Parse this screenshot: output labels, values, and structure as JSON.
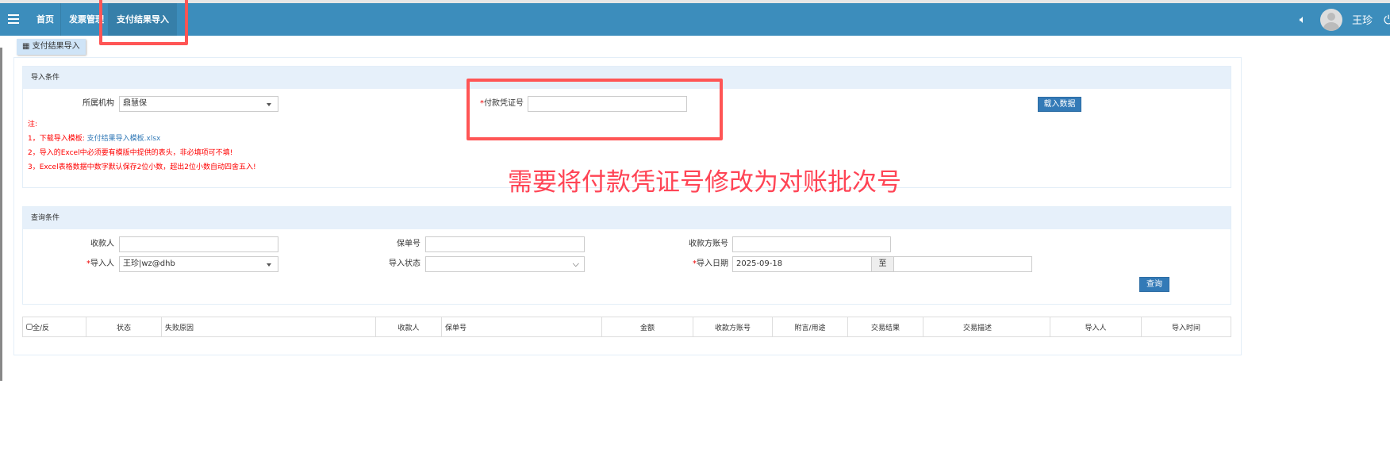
{
  "nav": {
    "items": [
      "首页",
      "发票管理",
      "支付结果导入"
    ],
    "active": "支付结果导入",
    "user": "王珍"
  },
  "tab": {
    "label": "支付结果导入"
  },
  "import": {
    "title": "导入条件",
    "org_label": "所属机构",
    "org_value": "鼎慧保",
    "voucher_label": "付款凭证号",
    "voucher_value": "",
    "load_button": "载入数据",
    "notes": {
      "head": "注:",
      "n1_prefix": "1，下载导入模板: ",
      "n1_link": "支付结果导入模板.xlsx",
      "n2": "2，导入的Excel中必须要有模版中提供的表头，非必填项可不填!",
      "n3": "3，Excel表格数据中数字默认保存2位小数，超出2位小数自动四舍五入!"
    }
  },
  "query": {
    "title": "查询条件",
    "payee_label": "收款人",
    "payee_value": "",
    "policy_label": "保单号",
    "policy_value": "",
    "account_label": "收款方账号",
    "account_value": "",
    "importer_label": "导入人",
    "importer_value": "王珍|wz@dhb",
    "status_label": "导入状态",
    "status_value": "",
    "date_label": "导入日期",
    "date_from": "2025-09-18",
    "date_sep": "至",
    "date_to": "",
    "query_button": "查询"
  },
  "table": {
    "check_all": "全/反",
    "columns": [
      "状态",
      "失败原因",
      "收款人",
      "保单号",
      "金额",
      "收款方账号",
      "附言/用途",
      "交易结果",
      "交易描述",
      "导入人",
      "导入时间"
    ]
  },
  "annotation": {
    "text": "需要将付款凭证号修改为对账批次号"
  },
  "colors": {
    "nav": "#3c8dbc",
    "accent": "#337ab7",
    "annotation": "#ff4455"
  }
}
